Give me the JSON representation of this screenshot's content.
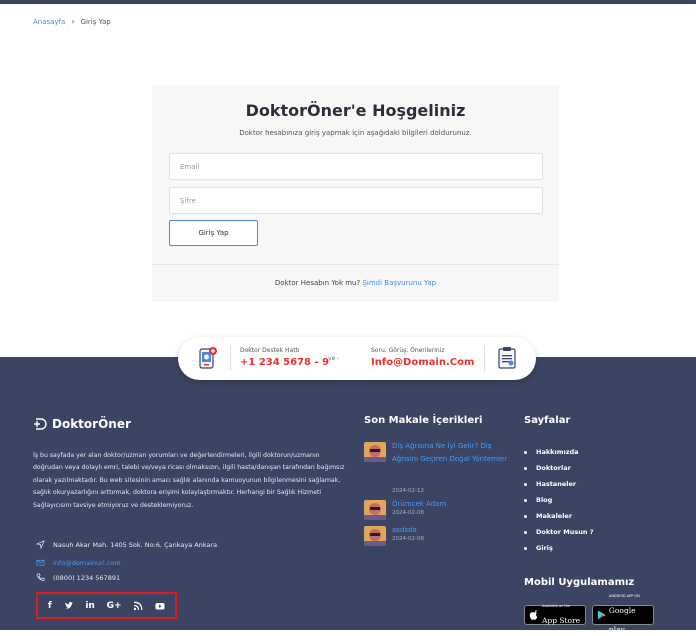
{
  "breadcrumb": {
    "home": "Anasayfa",
    "separator": "›",
    "current": "Giriş Yap"
  },
  "login": {
    "title": "DoktorÖner'e Hoşgeliniz",
    "subtitle": "Doktor hesabınıza giriş yapmak için aşağıdaki bilgileri doldurunuz.",
    "email_placeholder": "Email",
    "password_placeholder": "Şifre",
    "submit_label": "Giriş Yap",
    "register_prompt": "Doktor Hesabın Yok mu?",
    "register_link": "Şimdi Başvurunu Yap"
  },
  "support": {
    "hotline_label": "Doktor Destek Hattı",
    "hotline_number": "+1 234 5678 - 9",
    "separator": "- ve -",
    "suggest_label": "Soru, Görüş, Önerileriniz",
    "suggest_email": "Info@Domain.Com"
  },
  "footer": {
    "brand": "DoktorÖner",
    "about": "İş bu sayfada yer alan doktor/uzman yorumları ve değerlendirmeleri, ilgili doktorun/uzmanın doğrudan veya dolaylı emri, talebi ve/veya ricası olmaksızın, ilgili hasta/danışan tarafından bağımsız olarak yazılmaktadır. Bu web sitesinin amacı sağlık alanında kamuoyunun bilgilenmesini sağlamak, sağlık okuryazarlığını arttırmak, doktora erişimi kolaylaştırmaktır. Herhangi bir Sağlık Hizmeti Sağlayıcısını tavsiye etmiyoruz ve desteklemiyoruz.",
    "address": "Nasuh Akar Mah. 1405 Sok. No:6, Çankaya Ankara",
    "email": "info@domainuri.com",
    "phone": "(0800) 1234 567891",
    "articles_title": "Son Makale İçerikleri",
    "articles": [
      {
        "title": "Diş Ağrısına Ne İyi Gelir? Diş Ağrısını Geçiren Doğal Yöntemler",
        "date": "2024-02-12"
      },
      {
        "title": "Örümcek Adam",
        "date": "2024-02-08"
      },
      {
        "title": "asdsda",
        "date": "2024-02-08"
      }
    ],
    "pages_title": "Sayfalar",
    "pages": [
      "Hakkımızda",
      "Doktorlar",
      "Hastaneler",
      "Blog",
      "Makaleler",
      "Doktor Musun ?",
      "Giriş"
    ],
    "mobile_title": "Mobil Uygulamamız",
    "app_store": {
      "small": "Available on the",
      "big": "App Store"
    },
    "google_play": {
      "small": "ANDROID APP ON",
      "big": "Google play"
    },
    "social_icons": [
      "facebook-icon",
      "twitter-icon",
      "linkedin-icon",
      "google-plus-icon",
      "rss-icon",
      "youtube-icon"
    ]
  },
  "colors": {
    "footer_bg": "#3c4464",
    "accent_blue": "#4a86e8",
    "accent_red": "#e8332f",
    "highlight_border": "#e01b1b"
  }
}
